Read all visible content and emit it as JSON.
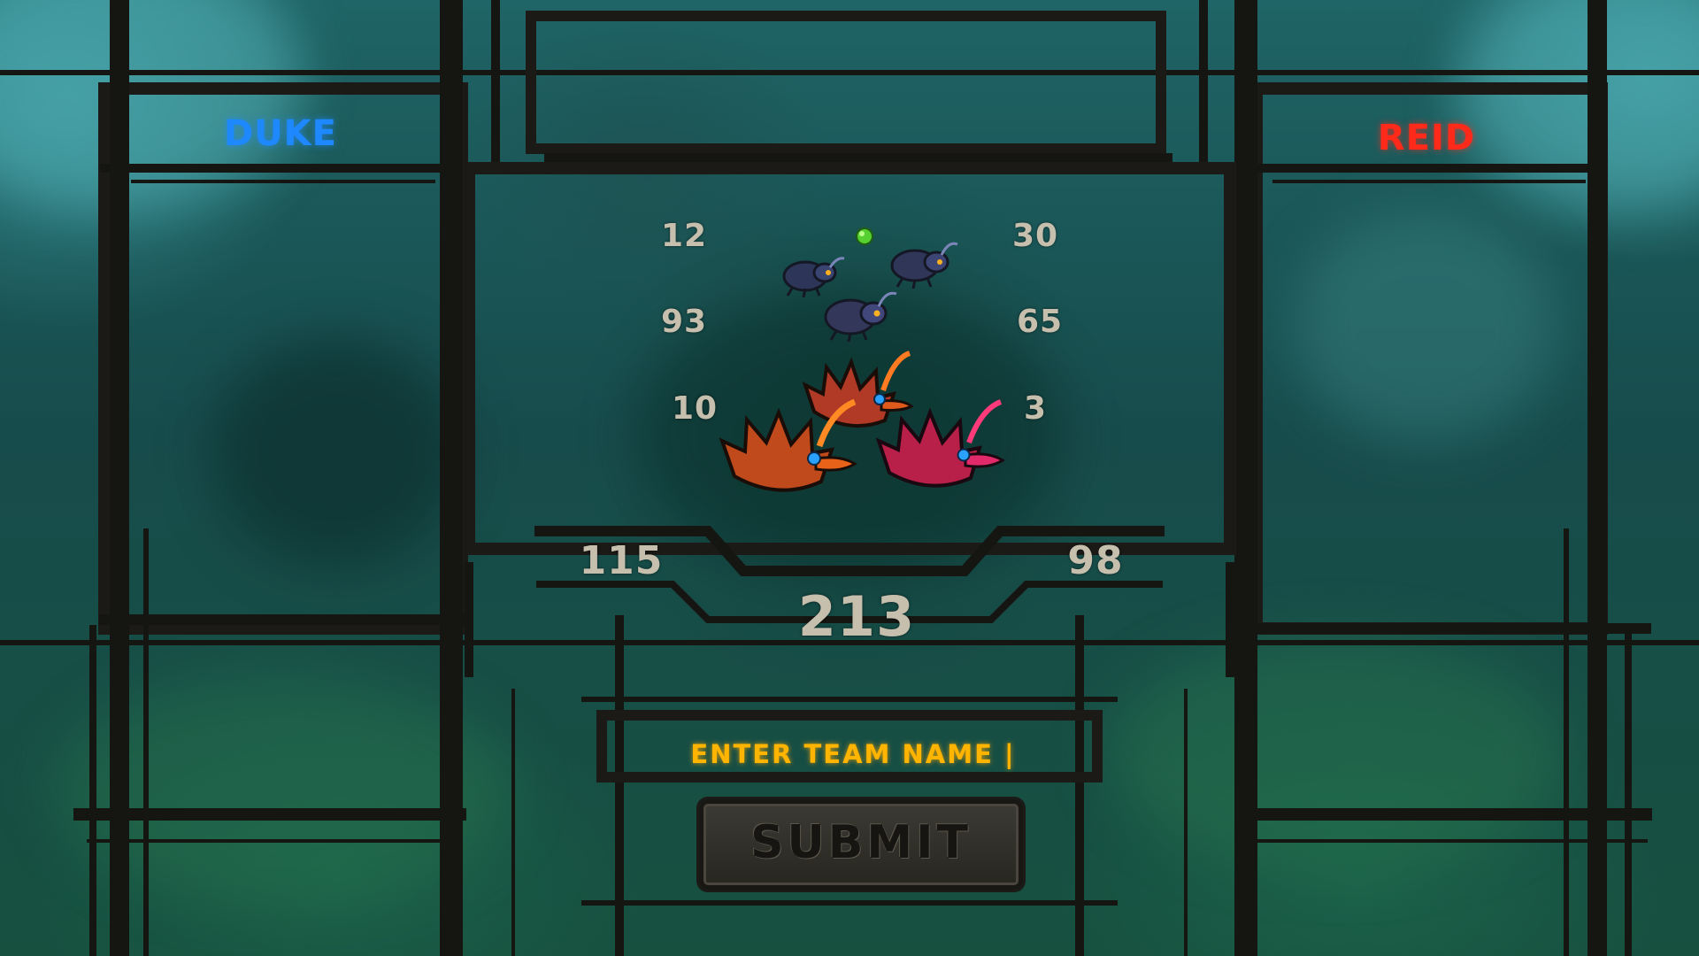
{
  "players": {
    "left": {
      "name": "DUKE",
      "color": "#1e88ff"
    },
    "right": {
      "name": "REID",
      "color": "#ff2a1a"
    }
  },
  "scores": {
    "left_rows": [
      "12",
      "93",
      "10"
    ],
    "right_rows": [
      "30",
      "65",
      "3"
    ],
    "left_total": "115",
    "right_total": "98",
    "grand_total": "213"
  },
  "team_entry": {
    "prompt": "ENTER TEAM NAME |"
  },
  "submit": {
    "label": "SUBMIT"
  },
  "icons": [
    "energy-orb-icon",
    "beetle-bug-icon",
    "spiky-crab-monster-icon"
  ]
}
